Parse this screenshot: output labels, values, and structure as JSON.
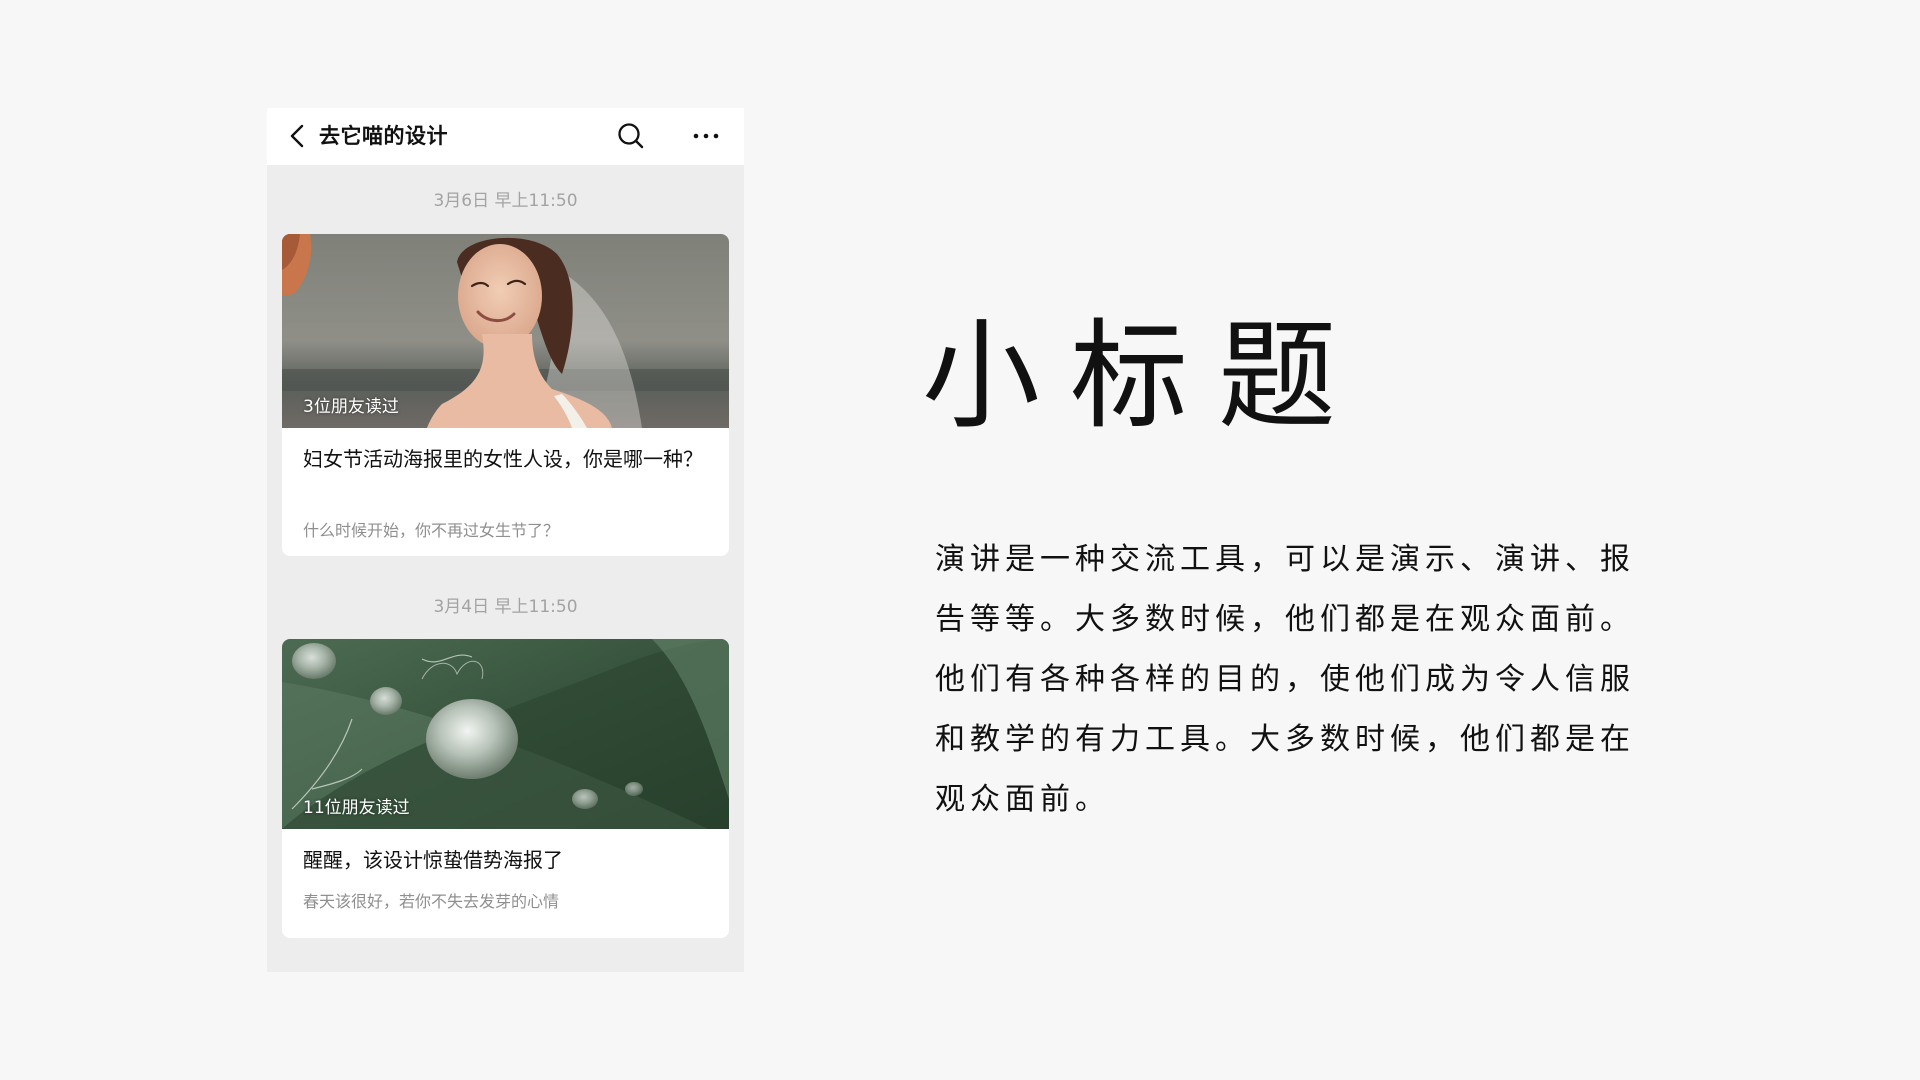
{
  "header": {
    "title": "去它喵的设计",
    "back_icon": "back-chevron-icon",
    "search_icon": "search-icon",
    "more_icon": "more-dots-icon"
  },
  "articles": [
    {
      "timestamp": "3月6日 早上11:50",
      "read_count": "3位朋友读过",
      "title": "妇女节活动海报里的女性人设，你是哪一种？",
      "summary": "什么时候开始，你不再过女生节了？",
      "cover": "smiling-bride-photo"
    },
    {
      "timestamp": "3月4日 早上11:50",
      "read_count": "11位朋友读过",
      "title": "醒醒，该设计惊蛰借势海报了",
      "summary": "春天该很好，若你不失去发芽的心情",
      "cover": "water-drops-on-leaf-photo"
    }
  ],
  "panel": {
    "subtitle": "小标题",
    "body": "演讲是一种交流工具，可以是演示、演讲、报告等等。大多数时候，他们都是在观众面前。他们有各种各样的目的，使他们成为令人信服和教学的有力工具。大多数时候，他们都是在观众面前。"
  },
  "colors": {
    "background": "#f7f7f7",
    "phone_background": "#ededed",
    "card_background": "#ffffff",
    "muted_text": "#a3a3a3",
    "text": "#111111"
  }
}
